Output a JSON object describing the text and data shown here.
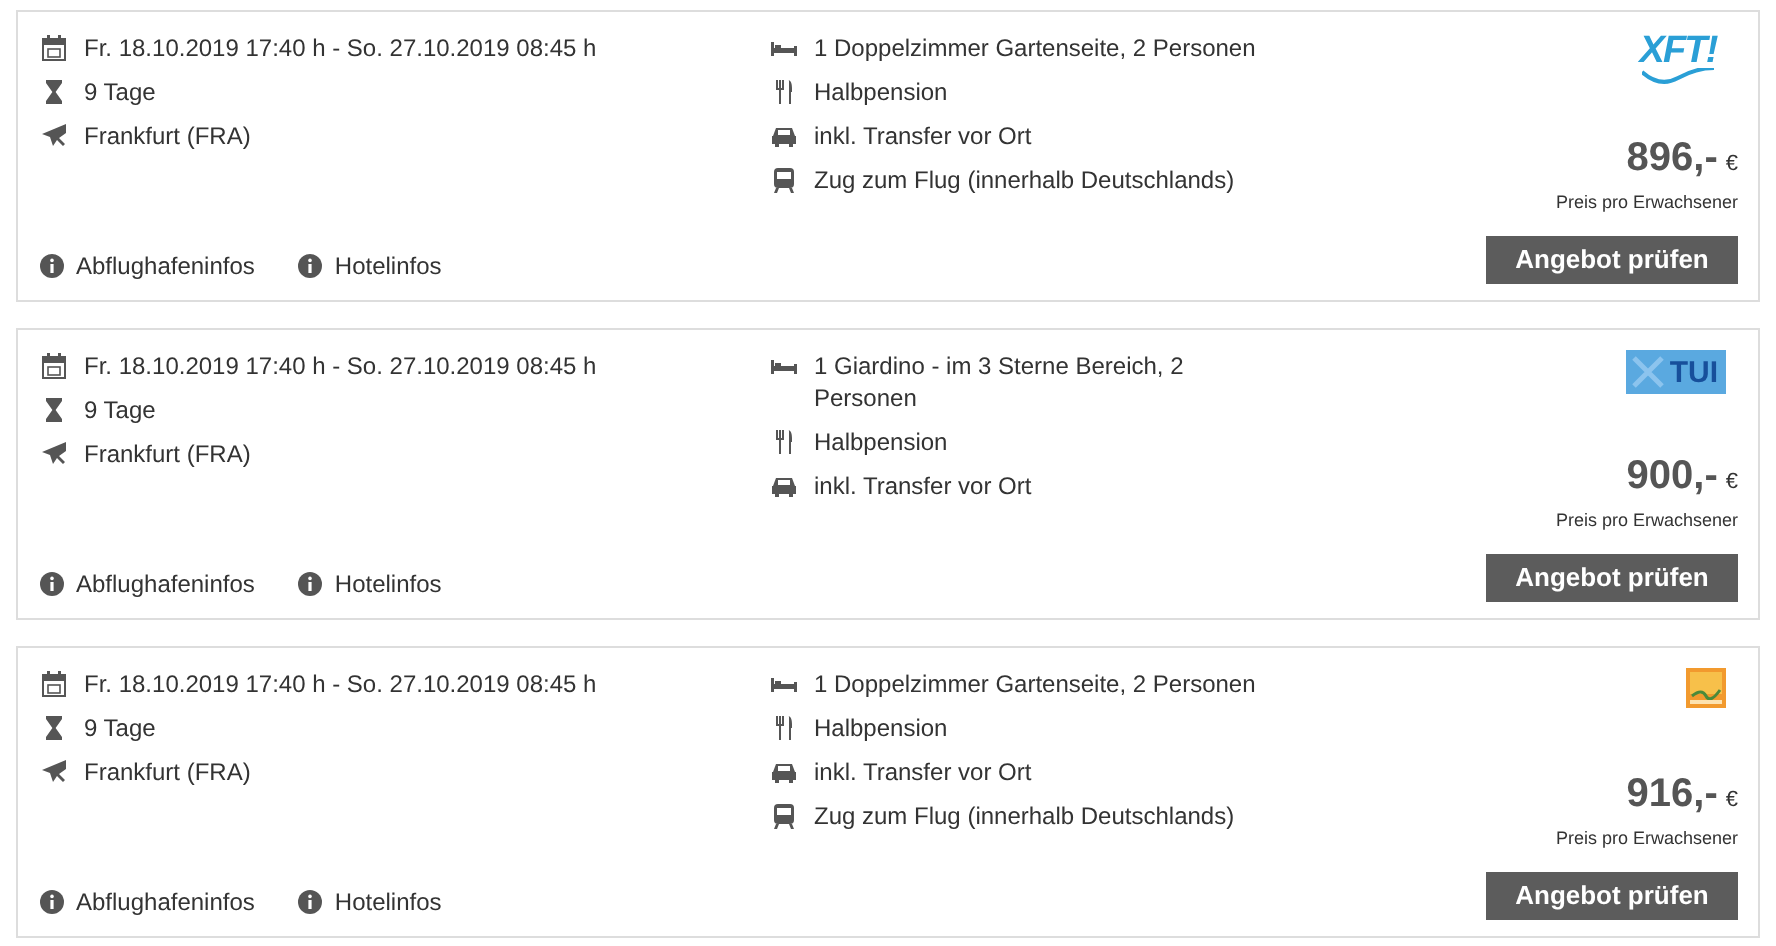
{
  "offers": [
    {
      "trip": [
        {
          "kind": "calendar",
          "text": "Fr. 18.10.2019 17:40 h - So. 27.10.2019 08:45 h"
        },
        {
          "kind": "duration",
          "text": "9 Tage"
        },
        {
          "kind": "flight",
          "text": "Frankfurt (FRA)"
        }
      ],
      "services": [
        {
          "kind": "bed",
          "text": "1 Doppelzimmer Gartenseite, 2 Personen"
        },
        {
          "kind": "food",
          "text": "Halbpension"
        },
        {
          "kind": "car",
          "text": "inkl. Transfer vor Ort"
        },
        {
          "kind": "train",
          "text": "Zug zum Flug (innerhalb Deutschlands)"
        }
      ],
      "logo": {
        "kind": "xfti",
        "text": "XFT!"
      },
      "price": "896,-",
      "currency": "€",
      "price_note": "Preis pro Erwachsener",
      "button": "Angebot prüfen",
      "links": [
        "Abflughafeninfos",
        "Hotelinfos"
      ]
    },
    {
      "trip": [
        {
          "kind": "calendar",
          "text": "Fr. 18.10.2019 17:40 h - So. 27.10.2019 08:45 h"
        },
        {
          "kind": "duration",
          "text": "9 Tage"
        },
        {
          "kind": "flight",
          "text": "Frankfurt (FRA)"
        }
      ],
      "services": [
        {
          "kind": "bed",
          "text": "1 Giardino - im 3 Sterne Bereich, 2 Personen"
        },
        {
          "kind": "food",
          "text": "Halbpension"
        },
        {
          "kind": "car",
          "text": "inkl. Transfer vor Ort"
        }
      ],
      "logo": {
        "kind": "xtui",
        "text": "TUI"
      },
      "price": "900,-",
      "currency": "€",
      "price_note": "Preis pro Erwachsener",
      "button": "Angebot prüfen",
      "links": [
        "Abflughafeninfos",
        "Hotelinfos"
      ]
    },
    {
      "trip": [
        {
          "kind": "calendar",
          "text": "Fr. 18.10.2019 17:40 h - So. 27.10.2019 08:45 h"
        },
        {
          "kind": "duration",
          "text": "9 Tage"
        },
        {
          "kind": "flight",
          "text": "Frankfurt (FRA)"
        }
      ],
      "services": [
        {
          "kind": "bed",
          "text": "1 Doppelzimmer Gartenseite, 2 Personen"
        },
        {
          "kind": "food",
          "text": "Halbpension"
        },
        {
          "kind": "car",
          "text": "inkl. Transfer vor Ort"
        },
        {
          "kind": "train",
          "text": "Zug zum Flug (innerhalb Deutschlands)"
        }
      ],
      "logo": {
        "kind": "fti"
      },
      "price": "916,-",
      "currency": "€",
      "price_note": "Preis pro Erwachsener",
      "button": "Angebot prüfen",
      "links": [
        "Abflughafeninfos",
        "Hotelinfos"
      ]
    }
  ]
}
